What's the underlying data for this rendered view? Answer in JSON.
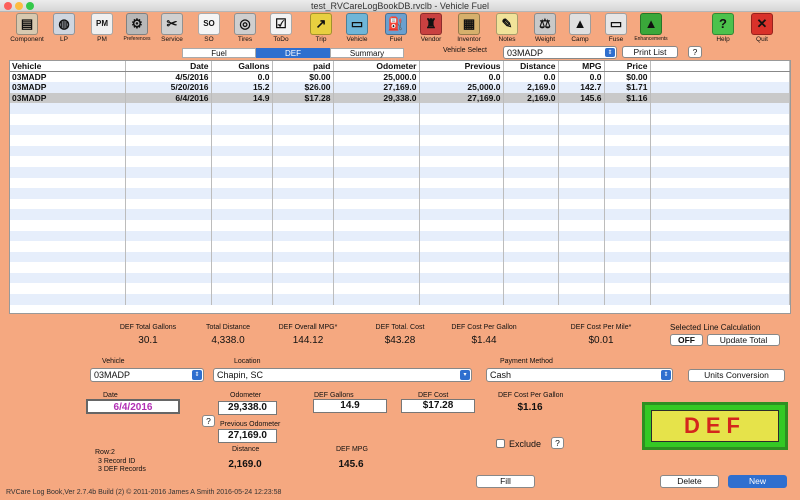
{
  "window": {
    "title": "test_RVCareLogBookDB.rvclb - Vehicle Fuel"
  },
  "colors": {
    "background": "#f5a880",
    "accent": "#2f6fcf",
    "def_banner_bg": "#34c924",
    "def_banner_inner": "#e6e34a",
    "def_banner_text": "#d4261c"
  },
  "toolbar": [
    {
      "label": "Component",
      "icon": "component-icon",
      "glyph": "▤",
      "color": "#d8c9b0"
    },
    {
      "label": "LP",
      "icon": "lp-tank-icon",
      "glyph": "◍",
      "color": "#cfd6e0"
    },
    {
      "label": "PM",
      "icon": "pm-icon",
      "glyph": "PM",
      "color": "#f0f0f0"
    },
    {
      "label": "Preferences",
      "icon": "gear-icon",
      "glyph": "⚙",
      "color": "#b8b8b8"
    },
    {
      "label": "Service",
      "icon": "tools-icon",
      "glyph": "✂",
      "color": "#d0d0d0"
    },
    {
      "label": "SO",
      "icon": "so-icon",
      "glyph": "SO",
      "color": "#f5f5f5"
    },
    {
      "label": "Tires",
      "icon": "tire-icon",
      "glyph": "◎",
      "color": "#cfcfcf"
    },
    {
      "label": "ToDo",
      "icon": "todo-icon",
      "glyph": "☑",
      "color": "#f3f3f3"
    },
    {
      "label": "Trip",
      "icon": "trip-icon",
      "glyph": "↗",
      "color": "#e8d040"
    },
    {
      "label": "Vehicle",
      "icon": "vehicle-icon",
      "glyph": "▭",
      "color": "#6fb6d8"
    },
    {
      "label": "Fuel",
      "icon": "fuel-icon",
      "glyph": "⛽",
      "color": "#6aa0d0"
    },
    {
      "label": "Vendor",
      "icon": "vendor-icon",
      "glyph": "♜",
      "color": "#c94040"
    },
    {
      "label": "Inventor",
      "icon": "inventory-icon",
      "glyph": "▦",
      "color": "#d6b06c"
    },
    {
      "label": "Notes",
      "icon": "notes-icon",
      "glyph": "✎",
      "color": "#f1e39a"
    },
    {
      "label": "Weight",
      "icon": "scale-icon",
      "glyph": "⚖",
      "color": "#c9c9c9"
    },
    {
      "label": "Camp",
      "icon": "tent-icon",
      "glyph": "▲",
      "color": "#e0e0e0"
    },
    {
      "label": "Fuse",
      "icon": "fuse-icon",
      "glyph": "▭",
      "color": "#e6e6e6"
    },
    {
      "label": "Enhancements",
      "icon": "triangle-icon",
      "glyph": "▲",
      "color": "#3aa83a"
    },
    {
      "label": "Help",
      "icon": "help-icon",
      "glyph": "?",
      "color": "#4cc24c"
    },
    {
      "label": "Quit",
      "icon": "quit-icon",
      "glyph": "✕",
      "color": "#d9322a"
    }
  ],
  "tabs": [
    "Fuel",
    "DEF",
    "Summary"
  ],
  "active_tab": "DEF",
  "vehicle_select": {
    "label": "Vehicle Select",
    "value": "03MADP"
  },
  "print_list": "Print List",
  "help_q": "?",
  "table": {
    "columns": [
      "Vehicle",
      "Date",
      "Gallons",
      "paid",
      "Odometer",
      "Previous",
      "Distance",
      "MPG",
      "Price"
    ],
    "rows": [
      [
        "03MADP",
        "4/5/2016",
        "0.0",
        "$0.00",
        "25,000.0",
        "0.0",
        "0.0",
        "0.0",
        "$0.00"
      ],
      [
        "03MADP",
        "5/20/2016",
        "15.2",
        "$26.00",
        "27,169.0",
        "25,000.0",
        "2,169.0",
        "142.7",
        "$1.71"
      ],
      [
        "03MADP",
        "6/4/2016",
        "14.9",
        "$17.28",
        "29,338.0",
        "27,169.0",
        "2,169.0",
        "145.6",
        "$1.16"
      ]
    ],
    "selected_row": 2
  },
  "summary": [
    {
      "label": "DEF  Total Gallons",
      "value": "30.1"
    },
    {
      "label": "Total Distance",
      "value": "4,338.0"
    },
    {
      "label": "DEF Overall MPG*",
      "value": "144.12"
    },
    {
      "label": "DEF Total. Cost",
      "value": "$43.28"
    },
    {
      "label": "DEF Cost Per Gallon",
      "value": "$1.44"
    },
    {
      "label": "DEF Cost Per Mile*",
      "value": "$0.01"
    }
  ],
  "selected_line": {
    "label": "Selected Line Calculation",
    "toggle": "OFF",
    "update": "Update Total"
  },
  "form": {
    "vehicle_label": "Vehicle",
    "vehicle_value": "03MADP",
    "location_label": "Location",
    "location_value": "Chapin, SC",
    "payment_label": "Payment Method",
    "payment_value": "Cash",
    "units_conversion": "Units Conversion",
    "date_label": "Date",
    "date_value": "6/4/2016",
    "odometer_label": "Odometer",
    "odometer_value": "29,338.0",
    "prev_odometer_label": "Previous Odometer",
    "prev_odometer_value": "27,169.0",
    "gallons_label": "DEF Gallons",
    "gallons_value": "14.9",
    "cost_label": "DEF Cost",
    "cost_value": "$17.28",
    "cpg_label": "DEF Cost Per Gallon",
    "cpg_value": "$1.16",
    "distance_label": "Distance",
    "distance_value": "2,169.0",
    "mpg_label": "DEF MPG",
    "mpg_value": "145.6",
    "exclude_label": "Exclude",
    "row_info": "Row:2",
    "record_id": "3  Record ID",
    "def_records": "3  DEF Records",
    "q_mark": "?"
  },
  "def_banner": "DEF",
  "buttons": {
    "fill": "Fill",
    "delete": "Delete",
    "new": "New"
  },
  "footer": "RVCare Log Book,Ver 2.7.4b Build (2) © 2011-2016 James A Smith 2016-05-24 12:23:58"
}
